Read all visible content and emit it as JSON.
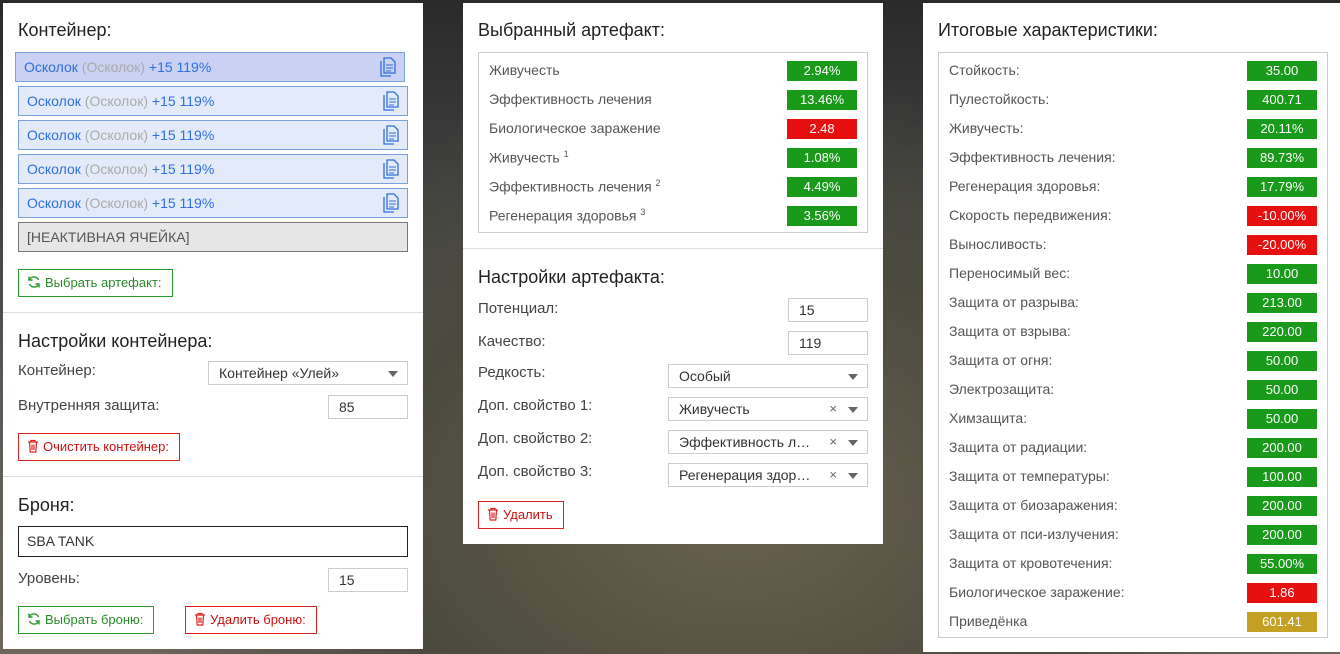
{
  "container": {
    "title": "Контейнер:",
    "slots": [
      {
        "name": "Осколок",
        "alt": "(Осколок)",
        "stat": "+15 119%"
      },
      {
        "name": "Осколок",
        "alt": "(Осколок)",
        "stat": "+15 119%"
      },
      {
        "name": "Осколок",
        "alt": "(Осколок)",
        "stat": "+15 119%"
      },
      {
        "name": "Осколок",
        "alt": "(Осколок)",
        "stat": "+15 119%"
      },
      {
        "name": "Осколок",
        "alt": "(Осколок)",
        "stat": "+15 119%"
      }
    ],
    "inactive_slot": "[НЕАКТИВНАЯ ЯЧЕЙКА]",
    "select_button": "Выбрать артефакт:"
  },
  "container_settings": {
    "title": "Настройки контейнера:",
    "container_label": "Контейнер:",
    "container_value": "Контейнер «Улей»",
    "inner_protection_label": "Внутренняя защита:",
    "inner_protection_value": "85",
    "clear_button": "Очистить контейнер:"
  },
  "armor": {
    "title": "Броня:",
    "name_value": "SBA TANK",
    "level_label": "Уровень:",
    "level_value": "15",
    "select_button": "Выбрать броню:",
    "delete_button": "Удалить броню:"
  },
  "selected_artifact": {
    "title": "Выбранный артефакт:",
    "stats": [
      {
        "name": "Живучесть",
        "sup": "",
        "value": "2.94%",
        "kind": "pos"
      },
      {
        "name": "Эффективность лечения",
        "sup": "",
        "value": "13.46%",
        "kind": "pos"
      },
      {
        "name": "Биологическое заражение",
        "sup": "",
        "value": "2.48",
        "kind": "neg"
      },
      {
        "name": "Живучесть",
        "sup": "1",
        "value": "1.08%",
        "kind": "pos"
      },
      {
        "name": "Эффективность лечения",
        "sup": "2",
        "value": "4.49%",
        "kind": "pos"
      },
      {
        "name": "Регенерация здоровья",
        "sup": "3",
        "value": "3.56%",
        "kind": "pos"
      }
    ]
  },
  "artifact_settings": {
    "title": "Настройки артефакта:",
    "potential_label": "Потенциал:",
    "potential_value": "15",
    "quality_label": "Качество:",
    "quality_value": "119",
    "rarity_label": "Редкость:",
    "rarity_value": "Особый",
    "extra1_label": "Доп. свойство 1:",
    "extra1_value": "Живучесть",
    "extra2_label": "Доп. свойство 2:",
    "extra2_value": "Эффективность лечения",
    "extra3_label": "Доп. свойство 3:",
    "extra3_value": "Регенерация здоровья",
    "clear_mark": "×",
    "delete_button": "Удалить"
  },
  "totals": {
    "title": "Итоговые характеристики:",
    "stats": [
      {
        "name": "Стойкость:",
        "value": "35.00",
        "kind": "pos"
      },
      {
        "name": "Пулестойкость:",
        "value": "400.71",
        "kind": "pos"
      },
      {
        "name": "Живучесть:",
        "value": "20.11%",
        "kind": "pos"
      },
      {
        "name": "Эффективность лечения:",
        "value": "89.73%",
        "kind": "pos"
      },
      {
        "name": "Регенерация здоровья:",
        "value": "17.79%",
        "kind": "pos"
      },
      {
        "name": "Скорость передвижения:",
        "value": "-10.00%",
        "kind": "neg"
      },
      {
        "name": "Выносливость:",
        "value": "-20.00%",
        "kind": "neg"
      },
      {
        "name": "Переносимый вес:",
        "value": "10.00",
        "kind": "pos"
      },
      {
        "name": "Защита от разрыва:",
        "value": "213.00",
        "kind": "pos"
      },
      {
        "name": "Защита от взрыва:",
        "value": "220.00",
        "kind": "pos"
      },
      {
        "name": "Защита от огня:",
        "value": "50.00",
        "kind": "pos"
      },
      {
        "name": "Электрозащита:",
        "value": "50.00",
        "kind": "pos"
      },
      {
        "name": "Химзащита:",
        "value": "50.00",
        "kind": "pos"
      },
      {
        "name": "Защита от радиации:",
        "value": "200.00",
        "kind": "pos"
      },
      {
        "name": "Защита от температуры:",
        "value": "100.00",
        "kind": "pos"
      },
      {
        "name": "Защита от биозаражения:",
        "value": "200.00",
        "kind": "pos"
      },
      {
        "name": "Защита от пси-излучения:",
        "value": "200.00",
        "kind": "pos"
      },
      {
        "name": "Защита от кровотечения:",
        "value": "55.00%",
        "kind": "pos"
      },
      {
        "name": "Биологическое заражение:",
        "value": "1.86",
        "kind": "neg"
      },
      {
        "name": "Приведёнка",
        "value": "601.41",
        "kind": "neu"
      }
    ]
  }
}
